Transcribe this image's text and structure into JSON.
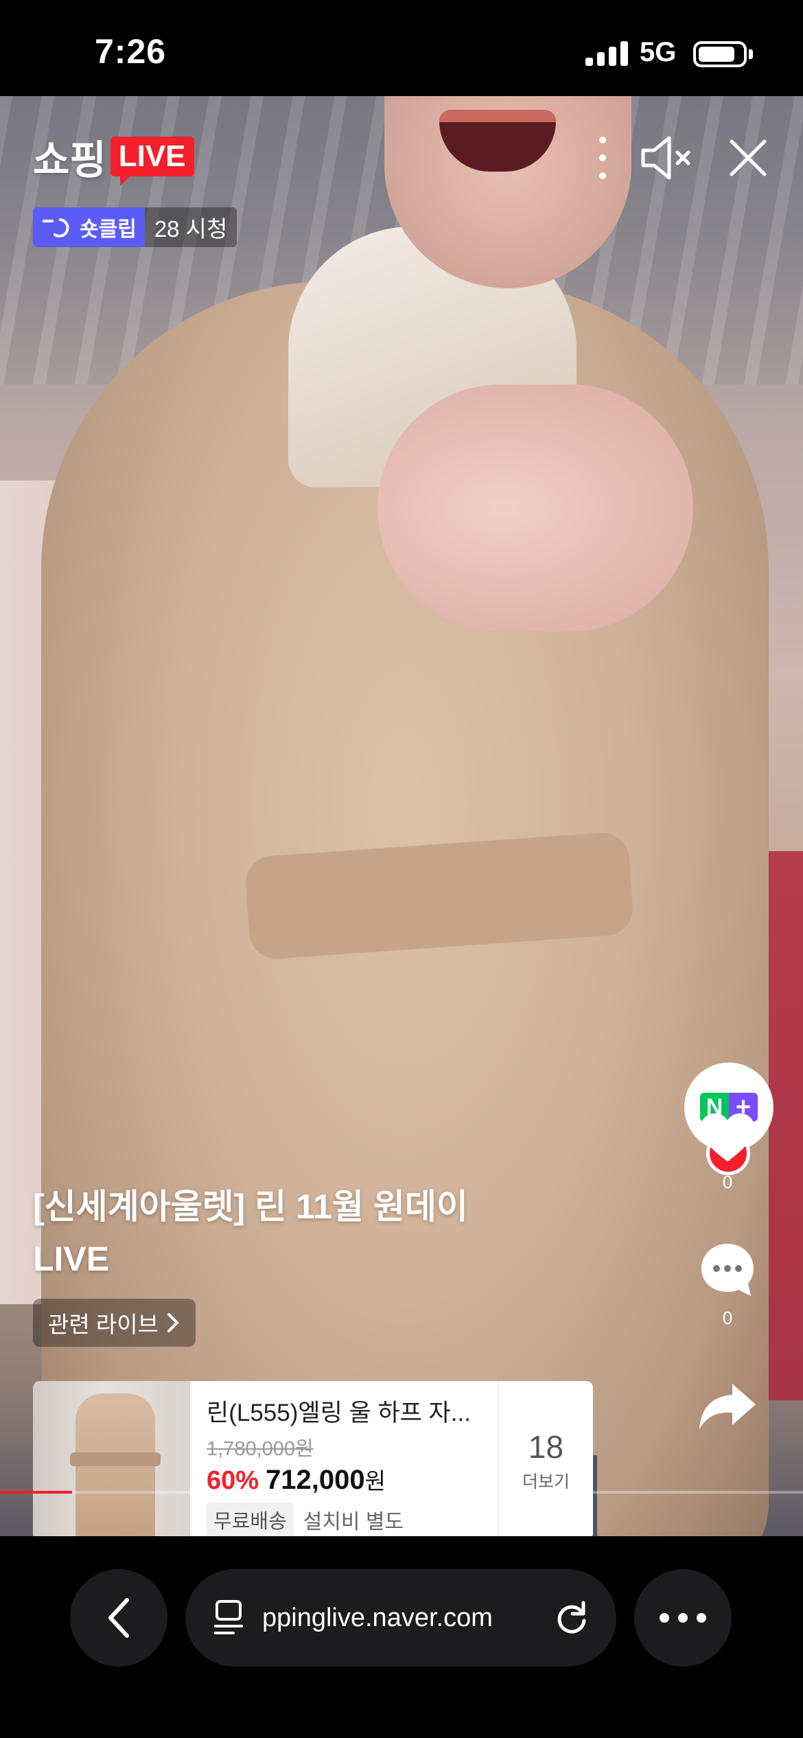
{
  "status_bar": {
    "time": "7:26",
    "network": "5G"
  },
  "header": {
    "logo_text": "쇼핑",
    "logo_badge": "LIVE",
    "clip_label": "숏클립",
    "viewers": "28 시청"
  },
  "icons": {
    "more": "more-vertical-icon",
    "mute": "speaker-muted-icon",
    "close": "close-icon"
  },
  "live": {
    "title": "[신세계아울렛] 린 11월 원데이 LIVE",
    "related_label": "관련 라이브"
  },
  "rail": {
    "naver_plus_n": "N",
    "naver_plus_p": "+",
    "follow_plus": "+",
    "like_count": "0",
    "comment_count": "0"
  },
  "product": {
    "name": "린(L555)엘링 울 하프 자...",
    "original_price": "1,780,000원",
    "discount": "60%",
    "sale_price": "712,000",
    "currency": "원",
    "free_shipping": "무료배송",
    "install_note": "설치비 별도",
    "more_count": "18",
    "more_label": "더보기"
  },
  "progress": {
    "fraction": 0.09,
    "color": "#f3202c"
  },
  "browser": {
    "url": "ppinglive.naver.com"
  },
  "colors": {
    "accent_red": "#f3202c",
    "clip_purple": "#5a5cf6",
    "naver_green": "#03c75a"
  }
}
